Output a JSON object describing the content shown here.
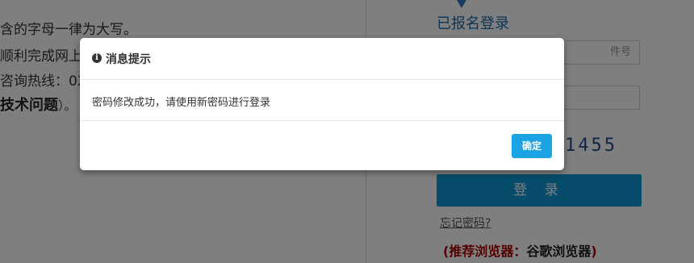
{
  "background": {
    "left_lines": [
      "含的字母一律为大写。",
      "顺利完成网上",
      "咨询热线：02"
    ],
    "tech_issue_bold": "技术问题",
    "tech_issue_tail": "）。",
    "login_title": "已报名登录",
    "id_placeholder": "件号",
    "captcha_text": "1455",
    "login_button_label": "登 录",
    "forgot_password_link": "忘记密码?",
    "browser_tip_prefix": "(推荐浏览器：",
    "browser_tip_name": "谷歌浏览器",
    "browser_tip_suffix": ")",
    "colors": {
      "accent": "#0f9ad6",
      "tip_red": "#b00000"
    }
  },
  "modal": {
    "icon": "info-icon",
    "title": "消息提示",
    "message": "密码修改成功，请使用新密码进行登录",
    "confirm_label": "确定",
    "colors": {
      "confirm_button": "#1ba3e3"
    }
  }
}
